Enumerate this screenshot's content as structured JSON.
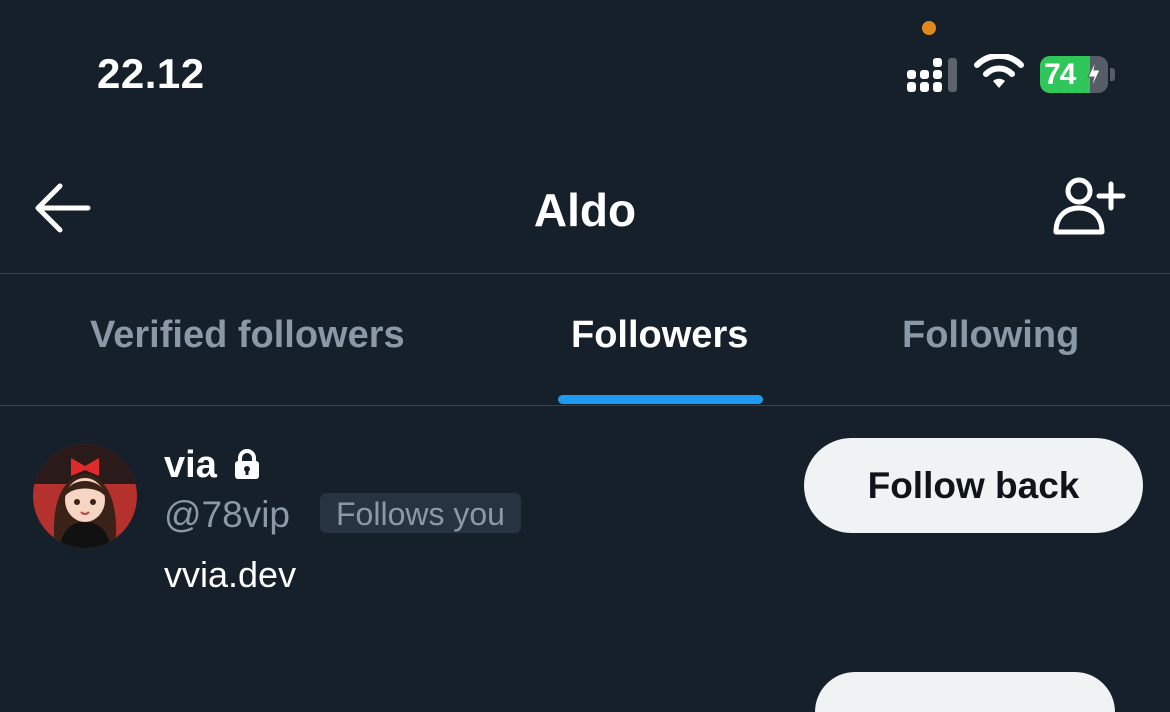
{
  "status_bar": {
    "time": "22.12",
    "battery_percent": "74",
    "battery_level": 0.74,
    "icons": [
      "signal-icon",
      "wifi-icon",
      "battery-icon",
      "charging-bolt-icon"
    ]
  },
  "header": {
    "title": "Aldo",
    "back_icon": "arrow-left-icon",
    "add_icon": "add-user-icon"
  },
  "tabs": [
    {
      "label": "Verified followers",
      "active": false
    },
    {
      "label": "Followers",
      "active": true
    },
    {
      "label": "Following",
      "active": false
    }
  ],
  "followers": [
    {
      "name": "via",
      "protected_icon": "lock-icon",
      "handle": "@78vip",
      "badge": "Follows you",
      "bio": "vvia.dev",
      "button_label": "Follow back"
    }
  ],
  "colors": {
    "background": "#15202b",
    "accent": "#1d9bf0",
    "muted_text": "#8b98a5",
    "divider": "#38444d",
    "battery_green": "#30c75a",
    "mic_indicator": "#e0891b"
  }
}
